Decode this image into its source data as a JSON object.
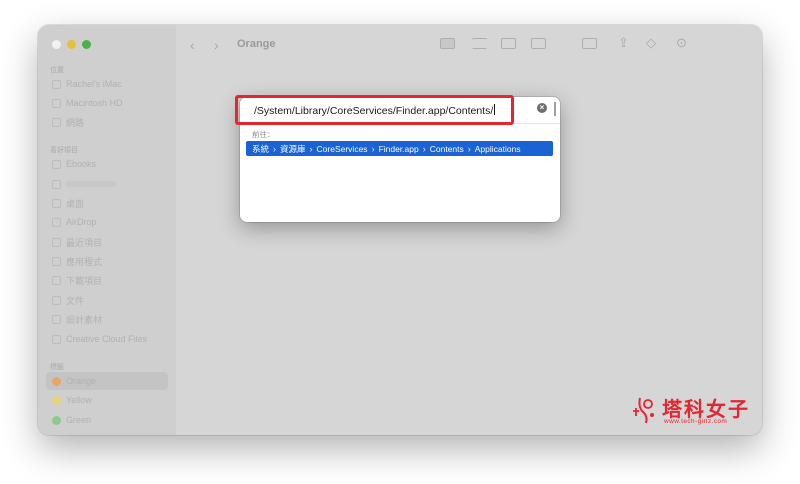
{
  "window": {
    "title": "Orange"
  },
  "sidebar": {
    "sections": [
      {
        "label": "位置",
        "items": [
          {
            "label": "Rachel's iMac",
            "icon": "desktop-icon"
          },
          {
            "label": "Macintosh HD",
            "icon": "disk-icon"
          },
          {
            "label": "網路",
            "icon": "network-icon"
          }
        ]
      },
      {
        "label": "喜好項目",
        "items": [
          {
            "label": "Ebooks",
            "icon": "folder-icon"
          },
          {
            "label": "",
            "icon": "folder-icon"
          },
          {
            "label": "桌面",
            "icon": "desktop-icon"
          },
          {
            "label": "AirDrop",
            "icon": "airdrop-icon"
          },
          {
            "label": "最近項目",
            "icon": "clock-icon"
          },
          {
            "label": "應用程式",
            "icon": "apps-icon"
          },
          {
            "label": "下載項目",
            "icon": "download-icon"
          },
          {
            "label": "文件",
            "icon": "document-icon"
          },
          {
            "label": "設計素材",
            "icon": "folder-icon"
          },
          {
            "label": "Creative Cloud Files",
            "icon": "cloud-icon"
          }
        ]
      },
      {
        "label": "標籤",
        "items": [
          {
            "label": "Orange",
            "color": "#e7a56a",
            "selected": true
          },
          {
            "label": "Yellow",
            "color": "#e5d27a"
          },
          {
            "label": "Green",
            "color": "#8dca8b"
          }
        ]
      }
    ]
  },
  "dialog": {
    "path_value": "/System/Library/CoreServices/Finder.app/Contents/",
    "goto_label": "前往：",
    "suggestion": [
      "系統",
      "資源庫",
      "CoreServices",
      "Finder.app",
      "Contents",
      "Applications"
    ],
    "separator": "›",
    "clear_glyph": "×"
  },
  "watermark": {
    "title": "塔科女子",
    "url": "www.tech-girlz.com"
  },
  "colors": {
    "accent": "#1b62d4",
    "highlight": "#e3262f"
  }
}
